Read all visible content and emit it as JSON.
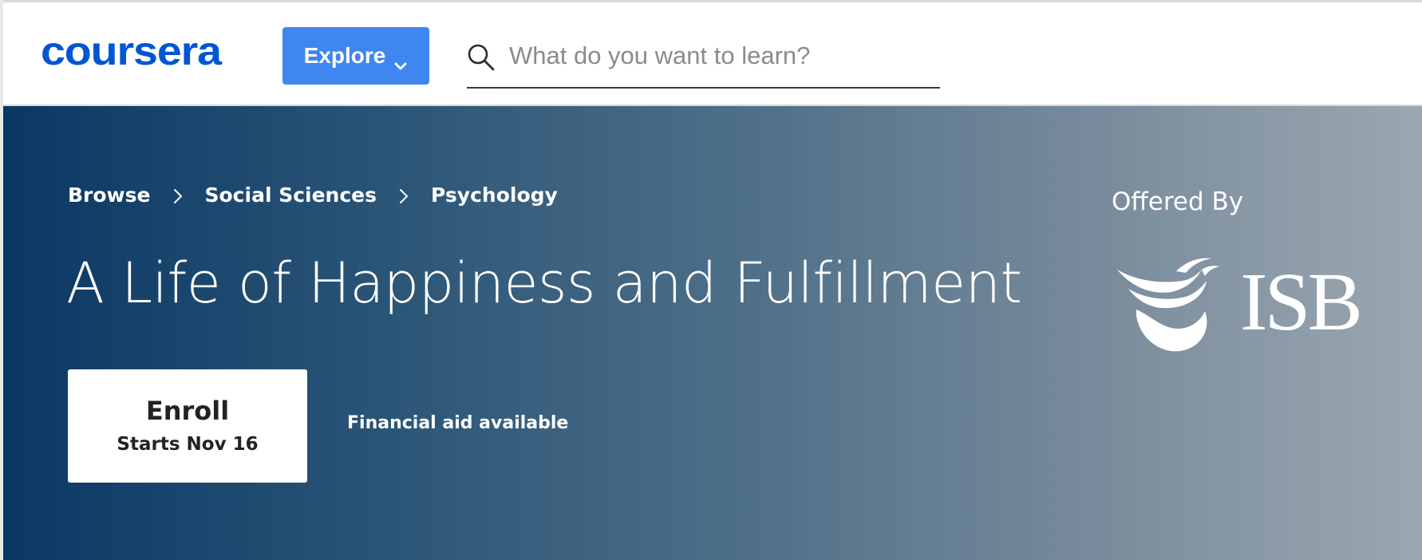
{
  "header": {
    "logo_text": "coursera",
    "explore_label": "Explore",
    "search": {
      "placeholder": "What do you want to learn?",
      "value": ""
    }
  },
  "hero": {
    "breadcrumbs": [
      "Browse",
      "Social Sciences",
      "Psychology"
    ],
    "title": "A Life of Happiness and Fulfillment",
    "enroll": {
      "label": "Enroll",
      "subtitle": "Starts Nov 16"
    },
    "financial_aid": "Financial aid available",
    "offered_by_label": "Offered By",
    "partner_name": "ISB"
  },
  "colors": {
    "brand_blue": "#0056d2",
    "explore_button": "#3f86f0",
    "hero_gradient_start": "#0b3764",
    "hero_gradient_end": "#9ba7b1"
  },
  "icons": {
    "search": "search-icon",
    "explore_chevron": "chevron-down-icon",
    "breadcrumb_separator": "chevron-right-icon",
    "partner_emblem": "bird-emblem-icon"
  }
}
